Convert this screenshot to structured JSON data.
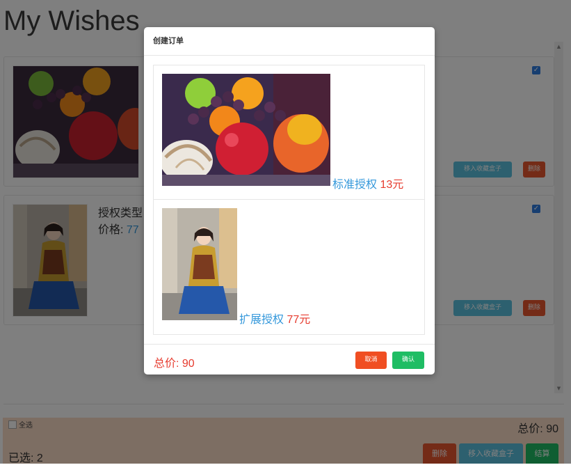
{
  "page": {
    "title": "My Wishes"
  },
  "wishes": [
    {
      "license_label": "",
      "price_label": "",
      "price": "",
      "checked": true,
      "fav_label": "移入收藏盒子",
      "delete_label": "删除"
    },
    {
      "license_label": "授权类型",
      "price_label": "价格:",
      "price": "77",
      "checked": true,
      "fav_label": "移入收藏盒子",
      "delete_label": "删除"
    }
  ],
  "footer": {
    "select_all": "全选",
    "total": "总价: 90",
    "selected": "已选: 2",
    "delete_label": "删除",
    "fav_label": "移入收藏盒子",
    "checkout_label": "结算"
  },
  "modal": {
    "title": "创建订单",
    "items": [
      {
        "license": "标准授权",
        "price": "13元",
        "image": "fruit-still-life-photo"
      },
      {
        "license": "扩展授权",
        "price": "77元",
        "image": "girl-portrait-photo"
      }
    ],
    "total": "总价: 90",
    "cancel_label": "取消",
    "confirm_label": "确认"
  },
  "colors": {
    "accent_blue": "#3498db",
    "price_red": "#e63b2e",
    "btn_info": "#5bc0de",
    "btn_danger": "#e8572f",
    "btn_success": "#1fbd64",
    "footer_bg": "#fbdcc6"
  }
}
